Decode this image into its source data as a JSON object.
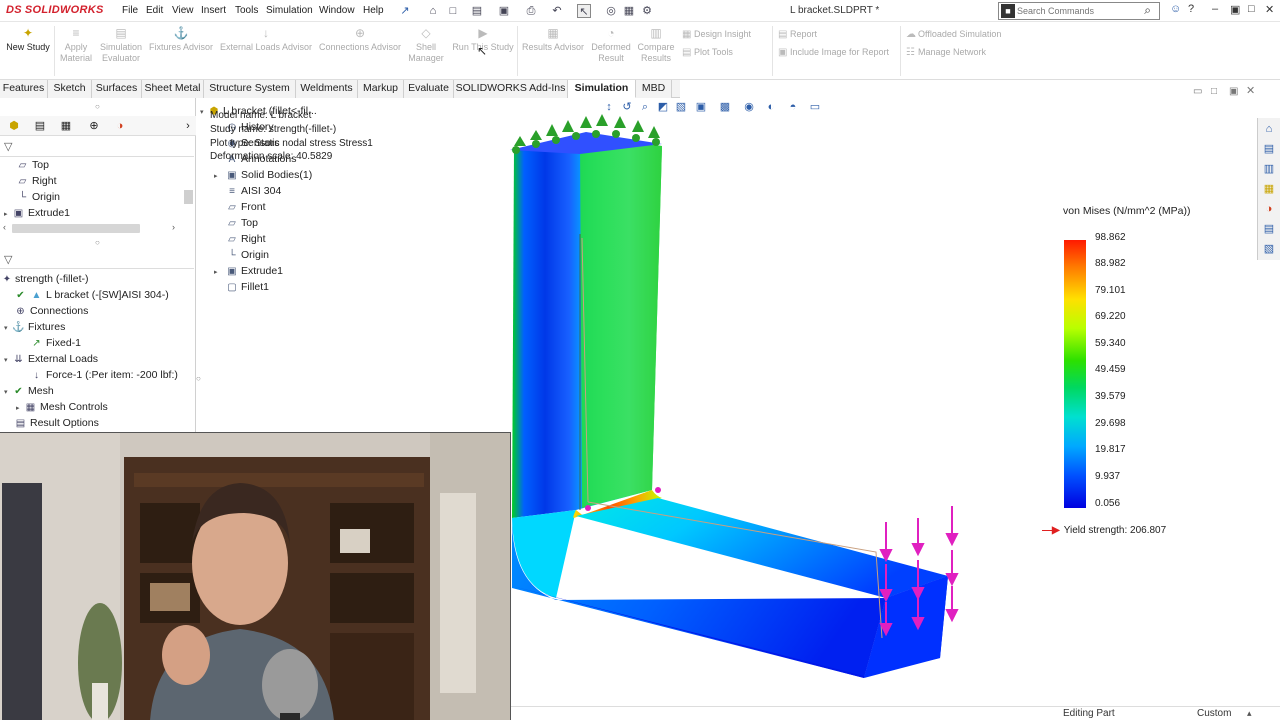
{
  "app": {
    "logo_text": "SOLIDWORKS",
    "logo_prefix": "DS",
    "document_title": "L bracket.SLDPRT *"
  },
  "menu": [
    "File",
    "Edit",
    "View",
    "Insert",
    "Tools",
    "Simulation",
    "Window",
    "Help"
  ],
  "search": {
    "placeholder": "Search Commands"
  },
  "ribbon": {
    "new_study": "New Study",
    "apply_material": "Apply Material",
    "simulation_evaluator": "Simulation Evaluator",
    "fixtures_advisor": "Fixtures Advisor",
    "external_loads_advisor": "External Loads Advisor",
    "connections_advisor": "Connections Advisor",
    "shell_manager": "Shell Manager",
    "run_this_study": "Run This Study",
    "results_advisor": "Results Advisor",
    "deformed_result": "Deformed Result",
    "compare_results": "Compare Results",
    "design_insight": "Design Insight",
    "plot_tools": "Plot Tools",
    "report": "Report",
    "include_image": "Include Image for Report",
    "offloaded_simulation": "Offloaded Simulation",
    "manage_network": "Manage Network"
  },
  "tabs": [
    "Features",
    "Sketch",
    "Surfaces",
    "Sheet Metal",
    "Structure System",
    "Weldments",
    "Markup",
    "Evaluate",
    "SOLIDWORKS Add-Ins",
    "Simulation",
    "MBD"
  ],
  "active_tab": "Simulation",
  "left_tree": {
    "top": [
      "Top",
      "Right",
      "Origin",
      "Extrude1"
    ],
    "study": "strength (-fillet-)",
    "part": "L bracket (-[SW]AISI 304-)",
    "connections": "Connections",
    "fixtures": "Fixtures",
    "fixed": "Fixed-1",
    "external_loads": "External Loads",
    "force": "Force-1 (:Per item: -200 lbf:)",
    "mesh": "Mesh",
    "mesh_controls": "Mesh Controls",
    "result_options": "Result Options"
  },
  "feature_tree": {
    "root": "L bracket  (fillet<-fil...",
    "history": "History",
    "sensors": "Sensors",
    "annotations": "Annotations",
    "solid_bodies": "Solid Bodies(1)",
    "material": "AISI 304",
    "front": "Front",
    "top": "Top",
    "right": "Right",
    "origin": "Origin",
    "extrude": "Extrude1",
    "fillet": "Fillet1"
  },
  "plot_info": {
    "model_name": "Model name: L bracket",
    "study_name": "Study name: strength(-fillet-)",
    "plot_type": "Plot type: Static nodal stress Stress1",
    "deformation_scale": "Deformation scale: 40.5829"
  },
  "legend": {
    "title": "von Mises (N/mm^2 (MPa))",
    "values": [
      "98.862",
      "88.982",
      "79.101",
      "69.220",
      "59.340",
      "49.459",
      "39.579",
      "29.698",
      "19.817",
      "9.937",
      "0.056"
    ],
    "yield_strength": "Yield strength: 206.807"
  },
  "status": {
    "mode": "Editing Part",
    "units": "Custom"
  },
  "colors": {
    "accent": "#d3212d",
    "load_arrows": "#e020c0",
    "fixture_green": "#2aa02a"
  }
}
